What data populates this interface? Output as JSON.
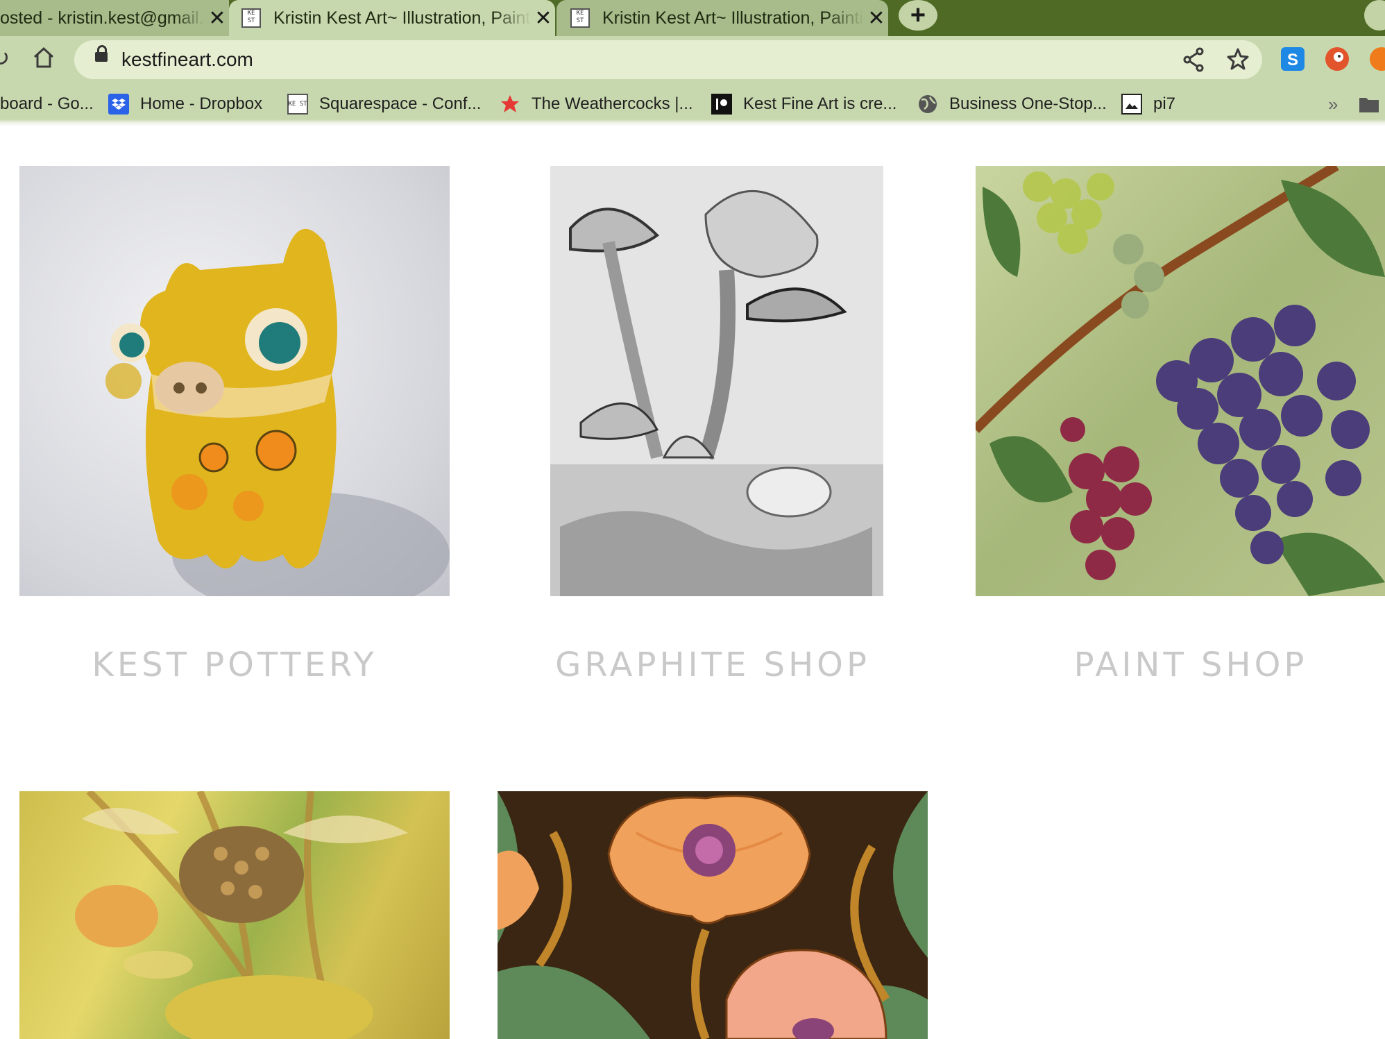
{
  "browser": {
    "tabs": [
      {
        "title": "osted - kristin.kest@gmail.com",
        "active": false
      },
      {
        "title": "Kristin Kest Art~ Illustration, Painting",
        "active": true
      },
      {
        "title": "Kristin Kest Art~ Illustration, Painting",
        "active": false
      }
    ],
    "close_glyph": "✕",
    "new_tab_glyph": "+",
    "favicon_text": "KE ST",
    "url": "kestfineart.com",
    "bookmarks": [
      {
        "label": "board - Go...",
        "icon": "none"
      },
      {
        "label": "Home - Dropbox",
        "icon": "dropbox-icon"
      },
      {
        "label": "Squarespace - Conf...",
        "icon": "kest-logo-icon"
      },
      {
        "label": "The Weathercocks |...",
        "icon": "red-star-icon"
      },
      {
        "label": "Kest Fine Art is cre...",
        "icon": "patreon-icon"
      },
      {
        "label": "Business One-Stop...",
        "icon": "globe-icon"
      },
      {
        "label": "pi7",
        "icon": "image-icon"
      }
    ],
    "overflow_glyph": "»",
    "colors": {
      "frame": "#4e6a24",
      "toolbar": "#c8d8ae",
      "omnibox": "#e6eed2"
    }
  },
  "gallery": {
    "items": [
      {
        "label": "KEST POTTERY",
        "image": "yellow ceramic creature pottery"
      },
      {
        "label": "GRAPHITE SHOP",
        "image": "graphite mushroom drawing"
      },
      {
        "label": "PAINT SHOP",
        "image": "grape vine painting"
      },
      {
        "label": "",
        "image": "winged seed pod painting"
      },
      {
        "label": "",
        "image": "orange poppy pattern painting"
      }
    ],
    "label_color": "#c9c9c9"
  }
}
